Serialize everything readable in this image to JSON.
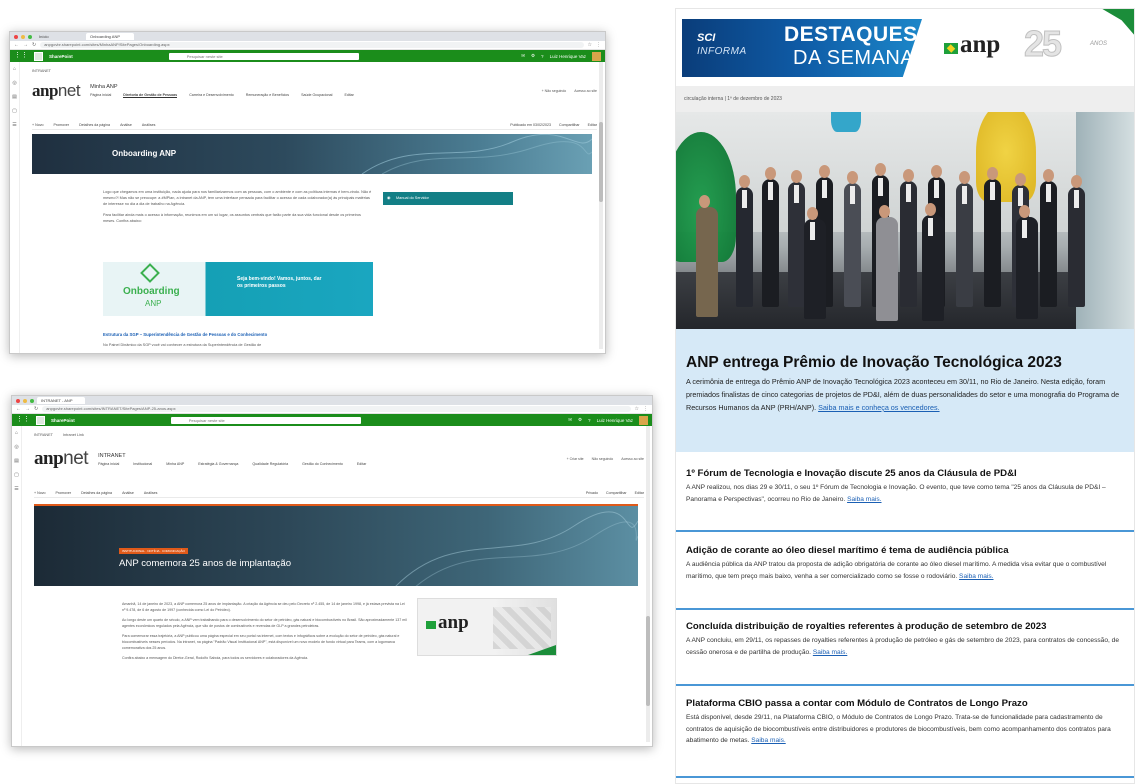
{
  "window1": {
    "tabs": [
      "Início",
      "Onboarding ANP"
    ],
    "url": "anpgovbr.sharepoint.com/sites/MinhaANP/SitePages/Onboarding.aspx",
    "suite_name": "SharePoint",
    "search_placeholder": "Pesquisar neste site",
    "suite_right": "Luiz Henrique Vaz",
    "breadcrumb": "INTRANET",
    "site_title": "Minha ANP",
    "nav": [
      "Página inicial",
      "Diretoria de Gestão de Pessoas",
      "Carreira e Desenvolvimento",
      "Remuneração e Benefícios",
      "Saúde Ocupacional",
      "Editar"
    ],
    "site_right": [
      "+ Não seguindo",
      "Acesso ao site"
    ],
    "cmd_left": [
      "+ Novo",
      "Promover",
      "Detalhes da página",
      "Análise",
      "Análises"
    ],
    "cmd_right": [
      "Publicado em 03/02/2023",
      "Compartilhar",
      "Editar"
    ],
    "hero_title": "Onboarding ANP",
    "paragraph1": "Logo que chegamos em uma instituição, nada ajuda para nos familiarizarmos com as pessoas, com o ambiente e com as políticas internas é bem-vindo. Não é mesmo?! Mas não se preocupe: a #MPlan, a intranet da ANP, tem uma interface pensada para facilitar o acesso de cada colaborador(a) às principais matérias de interesse no dia a dia de trabalho na Agência.",
    "paragraph2": "Para facilitar ainda mais o acesso à informação, reunimos em um só lugar, os assuntos centrais que farão parte da sua vida funcional desde os primeiros meses. Confira abaixo:",
    "banner_logo": "Onboarding",
    "banner_logo_sub": "ANP",
    "banner_text": "Seja bem-vindo! Vamos, juntos, dar os primeiros passos",
    "side_button": "Manual do Servidor",
    "section_title": "Estrutura da SGP – Superintendência de Gestão de Pessoas e do Conhecimento",
    "section_text": "No Painel Dinâmico da SGP você vai conhecer a estrutura da Superintendência de Gestão de"
  },
  "window2": {
    "tabs": [
      "INTRANET - ANP"
    ],
    "url": "anpgovbr.sharepoint.com/sites/INTRANET/SitePages/ANP-25-anos.aspx",
    "suite_name": "SharePoint",
    "search_placeholder": "Pesquisar neste site",
    "suite_right": "Luiz Henrique Vaz",
    "breadcrumb": "INTRANET",
    "breadcrumb2": "Intranet Link",
    "site_title": "INTRANET",
    "nav": [
      "Página inicial",
      "Institucional",
      "Minha ANP",
      "Estratégia & Governança",
      "Qualidade Regulatória",
      "Gestão do Conhecimento",
      "Editar"
    ],
    "site_right": [
      "+ Criar site",
      "Não seguindo",
      "Acesso ao site"
    ],
    "cmd_left": [
      "+ Novo",
      "Promover",
      "Detalhes da página",
      "Análise",
      "Análises"
    ],
    "cmd_right": [
      "Privado",
      "Compartilhar",
      "Editar"
    ],
    "hero_tag": "INSTITUCIONAL · NOTÍCIA · COMUNICAÇÃO",
    "hero_title": "ANP comemora 25 anos de implantação",
    "p1": "Amanhã, 14 de janeiro de 2023, a ANP comemora 25 anos de implantação. A criação da Agência se deu pelo Decreto nº 2.455, de 14 de janeiro 1998, e já estava prevista na Lei nº 9.478, de 6 de agosto de 1997 (conhecida como Lei do Petróleo).",
    "p2": "Ao longo deste um quarto de século, a ANP vem trabalhando para o desenvolvimento do setor de petróleo, gás natural e biocombustíveis no Brasil. São aproximadamente 137 mil agentes econômicos regulados pela Agência, que vão de postos de combustíveis e revendas de GLP a grandes petroleiras.",
    "p3": "Para comemorar essa trajetória, a ANP publicou uma página especial em seu portal na internet, com textos e infográficos sobre a evolução do setor de petróleo, gás natural e biocombustíveis nesses períodos. Na intranet, na página \"Padrão Visual Institucional ANP\", está disponível um novo modelo de fundo virtual para Teams, com a logomarca comemorativa dos 25 anos.",
    "p4": "Confira abaixo a mensagem do Diretor-Geral, Rodolfo Saboia, para todos os servidores e colaboradores da Agência.",
    "side_logo": "anp"
  },
  "newsletter": {
    "header_sci": "SCI",
    "header_informa": "INFORMA",
    "header_destaques": "DESTAQUES",
    "header_semana": "DA SEMANA",
    "header_anp": "anp",
    "header_25": "25",
    "header_anos": "ANOS",
    "circulation": "circulação interna | 1º de dezembro de 2023",
    "lead_title": "ANP entrega Prêmio de Inovação Tecnológica 2023",
    "lead_text": "A cerimônia de entrega do Prêmio ANP de Inovação Tecnológica 2023 aconteceu em 30/11, no Rio de Janeiro. Nesta edição, foram premiados finalistas de cinco categorias de projetos de PD&I, além de duas personalidades do setor e uma monografia do Programa de Recursos Humanos da ANP (PRH/ANP).",
    "lead_link": "Saiba mais e conheça os vencedores.",
    "items": [
      {
        "title": "1º Fórum de Tecnologia e Inovação discute 25 anos da Cláusula de PD&I",
        "text": "A ANP realizou, nos dias 29 e 30/11, o seu 1º Fórum de Tecnologia e Inovação. O evento, que teve como tema \"25 anos da Cláusula de PD&I – Panorama e Perspectivas\", ocorreu no Rio de Janeiro.",
        "link": "Saiba mais."
      },
      {
        "title": "Adição de corante ao óleo diesel marítimo é tema de audiência pública",
        "text": "A audiência pública da ANP tratou da proposta de adição obrigatória de corante ao óleo diesel marítimo. A medida visa evitar que o combustível marítimo, que tem preço mais baixo, venha a ser comercializado como se fosse o rodoviário.",
        "link": "Saiba mais."
      },
      {
        "title": "Concluída distribuição de royalties referentes à produção de setembro de 2023",
        "text": "A ANP concluiu, em 29/11, os repasses de royalties referentes à produção de petróleo e gás de setembro de 2023, para contratos de concessão, de cessão onerosa e de partilha de produção.",
        "link": "Saiba mais."
      },
      {
        "title": "Plataforma CBIO passa a contar com Módulo de Contratos de Longo Prazo",
        "text": "Está disponível, desde 29/11, na Plataforma CBIO, o Módulo de Contratos de Longo Prazo. Trata-se de funcionalidade para cadastramento de contratos de aquisição de biocombustíveis entre distribuidores e produtores de biocombustíveis, bem como acompanhamento dos contratos para abatimento de metas.",
        "link": "Saiba mais."
      }
    ]
  }
}
